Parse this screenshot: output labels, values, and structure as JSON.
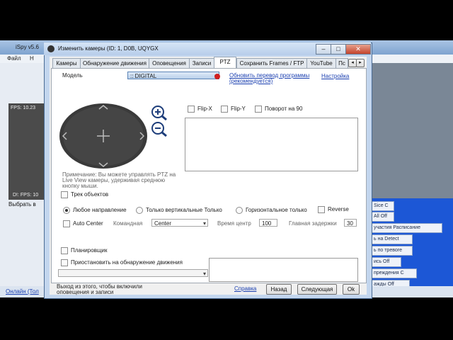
{
  "background_app": {
    "title": "iSpy v5.6",
    "menu": [
      "Файл",
      "Н"
    ],
    "camera_fps_top": "FPS: 10.23",
    "camera_fps_bottom": "D!: FPS: 10",
    "select_label": "Выбрать в",
    "online_link": "Онлайн (Тол",
    "right_buttons": [
      "Sice C",
      "All Off",
      "участия Расписание",
      "ь на Detect",
      "ь по тревоге",
      "ись Off",
      "преждения С",
      "ажды Off"
    ]
  },
  "dialog": {
    "title": "Изменить камеры (ID: 1, D0B, UQYGX",
    "window_buttons": {
      "minimize": "–",
      "maximize": "□",
      "close": "✕"
    },
    "tabs": [
      {
        "label": "Камеры",
        "active": false
      },
      {
        "label": "Обнаружение движения",
        "active": false
      },
      {
        "label": "Оповещения",
        "active": false
      },
      {
        "label": "Записи",
        "active": false
      },
      {
        "label": "PTZ",
        "active": true
      },
      {
        "label": "Сохранить Frames / FTP",
        "active": false
      },
      {
        "label": "YouTube",
        "active": false
      },
      {
        "label": "Пс",
        "active": false
      }
    ],
    "tab_scroll": [
      "◂",
      "▸"
    ],
    "ptz": {
      "model_label": "Модель",
      "model_value": ":: DIGITAL",
      "update_link": "Обновить перевод программы (рекомендуется)",
      "settings_link": "Настройка",
      "flip_x": "Flip-X",
      "flip_y": "Flip-Y",
      "rotate_90": "Поворот на 90",
      "note": "Примечание: Вы можете управлять PTZ на Live View камеры, удерживая среднюю кнопку мыши.",
      "track_objects": "Трек объектов",
      "direction_any": "Любое направление",
      "direction_vertical": "Только вертикальные Только",
      "direction_horizontal": "Горизонтальное только",
      "reverse": "Reverse",
      "auto_center": "Auto Center",
      "command_label": "Командная",
      "command_value": "Center",
      "center_time_label": "Время центр",
      "center_time_value": "100",
      "main_delay_label": "Главная задержки",
      "main_delay_value": "30",
      "scheduler": "Планировщик",
      "pause_on_motion": "Приостановить на обнаружение движения"
    },
    "footer": {
      "note": "Выход из этого, чтобы включили оповещения и записи",
      "help_link": "Справка",
      "back": "Назад",
      "next": "Следующая",
      "ok": "Ok"
    }
  },
  "colors": {
    "accent_blue": "#1c57d6",
    "link": "#1a3fb0",
    "joystick": "#3a3a3a"
  }
}
